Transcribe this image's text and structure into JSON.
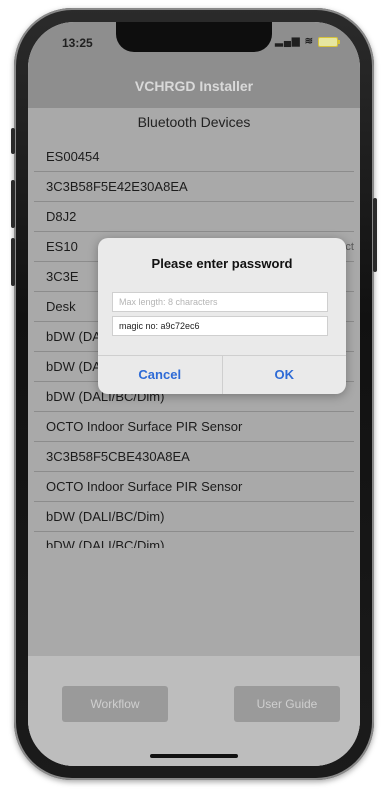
{
  "status": {
    "time": "13:25"
  },
  "nav": {
    "title": "VCHRGD Installer"
  },
  "list_header": "Bluetooth Devices",
  "devices": [
    {
      "label": "ES00454",
      "trail": ""
    },
    {
      "label": "3C3B58F5E42E30A8EA",
      "trail": ""
    },
    {
      "label": "D8J2",
      "trail": ""
    },
    {
      "label": "ES10",
      "trail": "nnect"
    },
    {
      "label": "3C3E",
      "trail": ""
    },
    {
      "label": "Desk",
      "trail": ""
    },
    {
      "label": "bDW (DALI/BC/Dim)",
      "trail": ""
    },
    {
      "label": "bDW (DALI/BC/Dim)",
      "trail": ""
    },
    {
      "label": "bDW (DALI/BC/Dim)",
      "trail": ""
    },
    {
      "label": "OCTO Indoor Surface PIR Sensor",
      "trail": ""
    },
    {
      "label": "3C3B58F5CBE430A8EA",
      "trail": ""
    },
    {
      "label": "OCTO Indoor Surface PIR Sensor",
      "trail": ""
    },
    {
      "label": "bDW (DALI/BC/Dim)",
      "trail": ""
    },
    {
      "label": "bDW (DALI/BC/Dim)",
      "trail": ""
    }
  ],
  "bottom": {
    "workflow_label": "Workflow",
    "guide_label": "User Guide"
  },
  "dialog": {
    "title": "Please enter password",
    "password_placeholder": "Max length: 8 characters",
    "magic_text": "magic no: a9c72ec6",
    "cancel_label": "Cancel",
    "ok_label": "OK"
  },
  "colors": {
    "accent": "#2e6bd6",
    "nav_bg": "#8e8e8e",
    "list_bg": "#a9a9a9"
  }
}
